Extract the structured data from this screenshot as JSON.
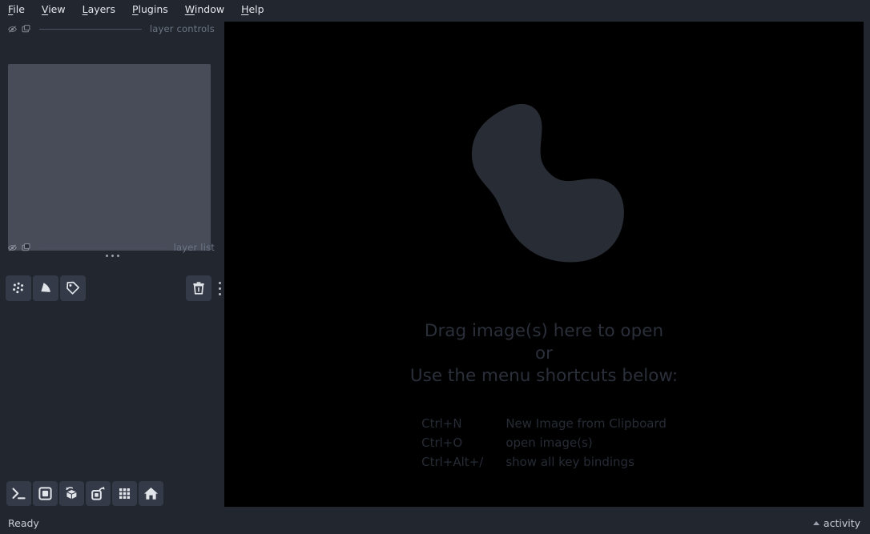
{
  "menubar": {
    "items": [
      {
        "mnemonic": "F",
        "rest": "ile",
        "name": "file"
      },
      {
        "mnemonic": "V",
        "rest": "iew",
        "name": "view"
      },
      {
        "mnemonic": "L",
        "rest": "ayers",
        "name": "layers"
      },
      {
        "mnemonic": "P",
        "rest": "lugins",
        "name": "plugins"
      },
      {
        "mnemonic": "W",
        "rest": "indow",
        "name": "window"
      },
      {
        "mnemonic": "H",
        "rest": "elp",
        "name": "help"
      }
    ]
  },
  "sidebar": {
    "layer_controls": {
      "label": "layer controls",
      "visibility_icon": "eye-slash-icon",
      "popout_icon": "popout-window-icon"
    },
    "layer_list": {
      "label": "layer list",
      "visibility_icon": "eye-slash-icon",
      "popout_icon": "popout-window-icon"
    },
    "splitter_handle": "splitter-dots-handle",
    "layer_tools": [
      {
        "name": "new-points-layer-button",
        "icon": "points-icon"
      },
      {
        "name": "new-shapes-layer-button",
        "icon": "shapes-icon"
      },
      {
        "name": "new-labels-layer-button",
        "icon": "labels-tag-icon"
      }
    ],
    "delete_button": {
      "name": "delete-layer-button",
      "icon": "trash-icon"
    },
    "overflow_menu": {
      "name": "layer-list-overflow-menu",
      "icon": "kebab-menu-icon"
    },
    "viewer_buttons": [
      {
        "name": "console-button",
        "icon": "terminal-icon"
      },
      {
        "name": "ndisplay-2d-button",
        "icon": "square-2d-icon"
      },
      {
        "name": "ndisplay-3d-button",
        "icon": "cube-3d-icon"
      },
      {
        "name": "roll-dimensions-button",
        "icon": "roll-square-arrow-icon"
      },
      {
        "name": "transpose-dimensions-button",
        "icon": "grid-icon"
      },
      {
        "name": "reset-view-button",
        "icon": "home-icon"
      }
    ]
  },
  "canvas": {
    "logo": "napari-blob-logo",
    "welcome": {
      "line1": "Drag image(s) here to open",
      "line2": "or",
      "line3": "Use the menu shortcuts below:"
    },
    "shortcuts": [
      {
        "key": "Ctrl+N",
        "description": "New Image from Clipboard"
      },
      {
        "key": "Ctrl+O",
        "description": "open image(s)"
      },
      {
        "key": "Ctrl+Alt+/",
        "description": "show all key bindings"
      }
    ]
  },
  "statusbar": {
    "status": "Ready",
    "activity_label": "activity",
    "activity_caret": "caret-up-icon"
  },
  "colors": {
    "app_background": "#22262e",
    "canvas_background": "#000000",
    "panel_background": "#474c58",
    "button_background": "#343a47",
    "text_primary": "#d4d7dd",
    "text_muted": "#6d7585",
    "canvas_text": "#2a2f3a",
    "logo_fill": "#282c35"
  }
}
